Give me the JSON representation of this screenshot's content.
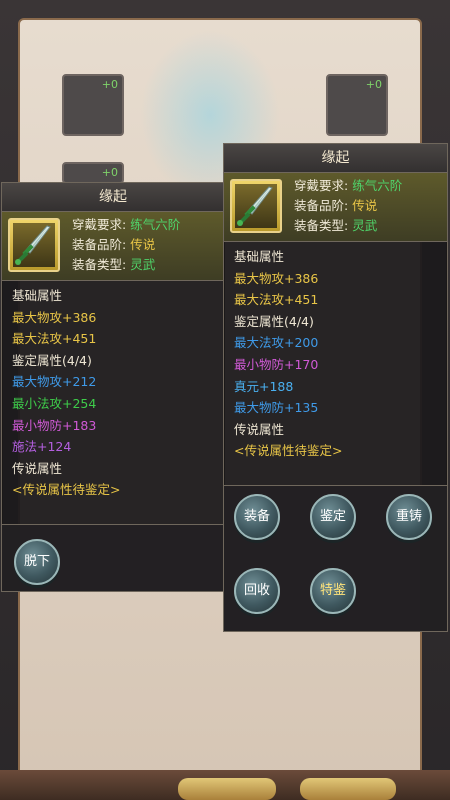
{
  "background": {
    "slot_bonus": [
      "+0",
      "+0",
      "+0"
    ],
    "left_edge_text": "",
    "bottom_progress": ""
  },
  "left_panel": {
    "title": "缘起",
    "requirements": {
      "wear_label": "穿戴要求:",
      "wear_value": "练气六阶",
      "grade_label": "装备品阶:",
      "grade_value": "传说",
      "type_label": "装备类型:",
      "type_value": "灵武"
    },
    "stats": [
      {
        "text": "基础属性",
        "color": "white"
      },
      {
        "text": "最大物攻+386",
        "color": "yellow"
      },
      {
        "text": "最大法攻+451",
        "color": "yellow"
      },
      {
        "text": "鉴定属性(4/4)",
        "color": "white"
      },
      {
        "text": "最大物攻+212",
        "color": "blue"
      },
      {
        "text": "最小法攻+254",
        "color": "green"
      },
      {
        "text": "最小物防+183",
        "color": "pink"
      },
      {
        "text": "施法+124",
        "color": "purple"
      },
      {
        "text": "传说属性",
        "color": "white"
      },
      {
        "text": "<传说属性待鉴定>",
        "color": "yellow"
      }
    ],
    "buttons": {
      "unequip": "脱下"
    }
  },
  "right_panel": {
    "title": "缘起",
    "requirements": {
      "wear_label": "穿戴要求:",
      "wear_value": "练气六阶",
      "grade_label": "装备品阶:",
      "grade_value": "传说",
      "type_label": "装备类型:",
      "type_value": "灵武"
    },
    "stats": [
      {
        "text": "基础属性",
        "color": "white"
      },
      {
        "text": "最大物攻+386",
        "color": "yellow"
      },
      {
        "text": "最大法攻+451",
        "color": "yellow"
      },
      {
        "text": "鉴定属性(4/4)",
        "color": "white"
      },
      {
        "text": "最大法攻+200",
        "color": "blue"
      },
      {
        "text": "最小物防+170",
        "color": "pink"
      },
      {
        "text": "真元+188",
        "color": "cyan"
      },
      {
        "text": "最大物防+135",
        "color": "blue"
      },
      {
        "text": "传说属性",
        "color": "white"
      },
      {
        "text": "<传说属性待鉴定>",
        "color": "yellow"
      }
    ],
    "buttons": {
      "equip": "装备",
      "appraise": "鉴定",
      "reforge": "重铸",
      "recycle": "回收",
      "special_appraise": "特鉴"
    }
  }
}
